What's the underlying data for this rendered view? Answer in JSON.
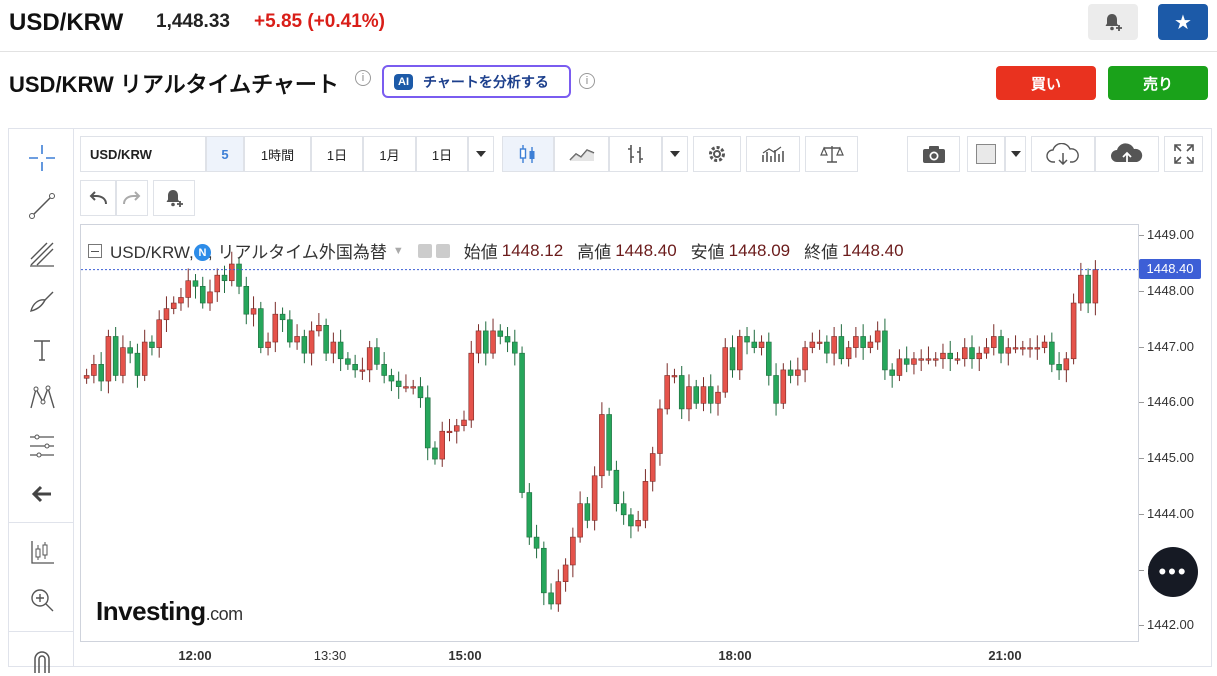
{
  "header": {
    "pair": "USD/KRW",
    "price": "1,448.33",
    "change": "+5.85",
    "change_pct": "(+0.41%)",
    "page_title": "USD/KRW リアルタイムチャート",
    "ai_badge": "AI",
    "ai_button": "チャートを分析する",
    "buy_label": "買い",
    "sell_label": "売り"
  },
  "toolbar": {
    "symbol": "USD/KRW",
    "interval": "5",
    "ranges": [
      "1時間",
      "1日",
      "1月",
      "1日"
    ]
  },
  "legend": {
    "title": "USD/KRW, 5, リアルタイム外国為替",
    "open_label": "始値",
    "open": "1448.12",
    "high_label": "高値",
    "high": "1448.40",
    "low_label": "安値",
    "low": "1448.09",
    "close_label": "終値",
    "close": "1448.40"
  },
  "news_badge": "N",
  "last_price_label": "1448.40",
  "logo": {
    "main": "Investing",
    "suffix": ".com"
  },
  "colors": {
    "up": "#26a65b",
    "down": "#e5534b",
    "accent": "#1c5aa8",
    "buy": "#e9321f",
    "sell": "#1aa21a"
  },
  "chart_data": {
    "type": "candlestick",
    "ylim": [
      1441.7,
      1449.2
    ],
    "yticks": [
      "1449.00",
      "1448.00",
      "1447.00",
      "1446.00",
      "1445.00",
      "1444.00",
      "1443.00",
      "1442.00"
    ],
    "xticks": [
      {
        "label": "12:00",
        "bold": true
      },
      {
        "label": "13:30",
        "bold": false
      },
      {
        "label": "15:00",
        "bold": true
      },
      {
        "label": "18:00",
        "bold": true
      },
      {
        "label": "21:00",
        "bold": true
      }
    ],
    "last_price": 1448.4,
    "close": [
      1446.5,
      1446.7,
      1446.4,
      1447.2,
      1446.5,
      1447.0,
      1446.9,
      1446.5,
      1447.1,
      1447.0,
      1447.5,
      1447.7,
      1447.8,
      1447.9,
      1448.2,
      1448.1,
      1447.8,
      1448.0,
      1448.3,
      1448.2,
      1448.5,
      1448.1,
      1447.6,
      1447.7,
      1447.0,
      1447.1,
      1447.6,
      1447.5,
      1447.1,
      1447.2,
      1446.9,
      1447.3,
      1447.4,
      1446.9,
      1447.1,
      1446.8,
      1446.7,
      1446.6,
      1446.6,
      1447.0,
      1446.7,
      1446.5,
      1446.4,
      1446.3,
      1446.3,
      1446.3,
      1446.1,
      1445.2,
      1445.0,
      1445.5,
      1445.5,
      1445.6,
      1445.7,
      1446.9,
      1447.3,
      1446.9,
      1447.3,
      1447.2,
      1447.1,
      1446.9,
      1444.4,
      1443.6,
      1443.4,
      1442.6,
      1442.4,
      1442.8,
      1443.1,
      1443.6,
      1444.2,
      1443.9,
      1444.7,
      1445.8,
      1444.8,
      1444.2,
      1444.0,
      1443.8,
      1443.9,
      1444.6,
      1445.1,
      1445.9,
      1446.5,
      1446.5,
      1445.9,
      1446.3,
      1446.0,
      1446.3,
      1446.0,
      1446.2,
      1447.0,
      1446.6,
      1447.2,
      1447.1,
      1447.0,
      1447.1,
      1446.5,
      1446.0,
      1446.6,
      1446.5,
      1446.6,
      1447.0,
      1447.1,
      1447.1,
      1446.9,
      1447.2,
      1446.8,
      1447.0,
      1447.2,
      1447.0,
      1447.1,
      1447.3,
      1446.6,
      1446.5,
      1446.8,
      1446.7,
      1446.8,
      1446.8,
      1446.8,
      1446.8,
      1446.9,
      1446.8,
      1446.8,
      1447.0,
      1446.8,
      1446.9,
      1447.0,
      1447.2,
      1446.9,
      1447.0,
      1447.0,
      1447.0,
      1447.0,
      1447.0,
      1447.1,
      1446.7,
      1446.6,
      1446.8,
      1447.8,
      1448.3,
      1447.8,
      1448.4
    ]
  }
}
